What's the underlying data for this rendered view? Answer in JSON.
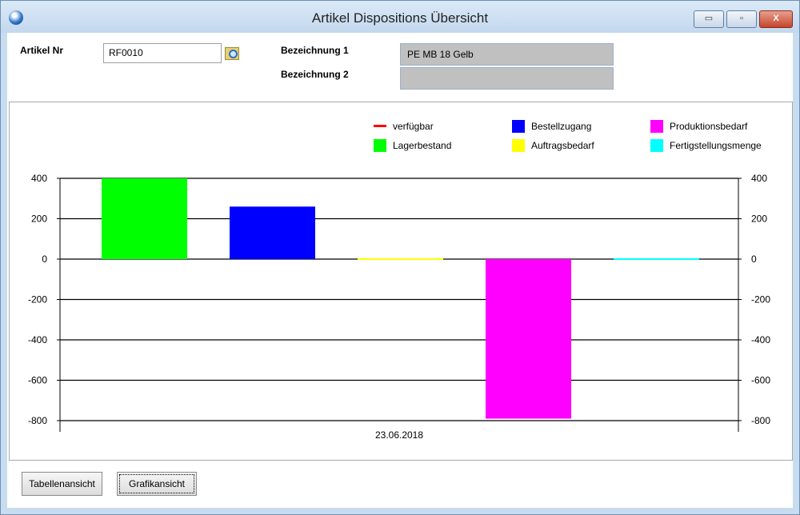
{
  "window": {
    "title": "Artikel Dispositions Übersicht",
    "minimize": "▭",
    "maximize": "▫",
    "close": "X"
  },
  "form": {
    "artikel_nr_label": "Artikel Nr",
    "artikel_nr_value": "RF0010",
    "bez1_label": "Bezeichnung 1",
    "bez1_value": "PE MB 18 Gelb",
    "bez2_label": "Bezeichnung 2",
    "bez2_value": ""
  },
  "buttons": {
    "table": "Tabellenansicht",
    "chart": "Grafikansicht"
  },
  "chart_data": {
    "type": "bar",
    "categories": [
      "23.06.2018"
    ],
    "xlabel": "23.06.2018",
    "ylim": [
      -800,
      400
    ],
    "yticks": [
      400,
      200,
      0,
      -200,
      -400,
      -600,
      -800
    ],
    "grid": true,
    "legend_placement": "top-right",
    "series": [
      {
        "name": "Lagerbestand",
        "color": "#00ff00",
        "values": [
          400
        ]
      },
      {
        "name": "Bestellzugang",
        "color": "#0000ff",
        "values": [
          260
        ]
      },
      {
        "name": "Auftragsbedarf",
        "color": "#ffff00",
        "values": [
          0
        ]
      },
      {
        "name": "Produktionsbedarf",
        "color": "#ff00ff",
        "values": [
          -790
        ]
      },
      {
        "name": "Fertigstellungsmenge",
        "color": "#00ffff",
        "values": [
          0
        ]
      }
    ],
    "line_series": [
      {
        "name": "verfügbar",
        "color": "#ff0000"
      }
    ]
  }
}
